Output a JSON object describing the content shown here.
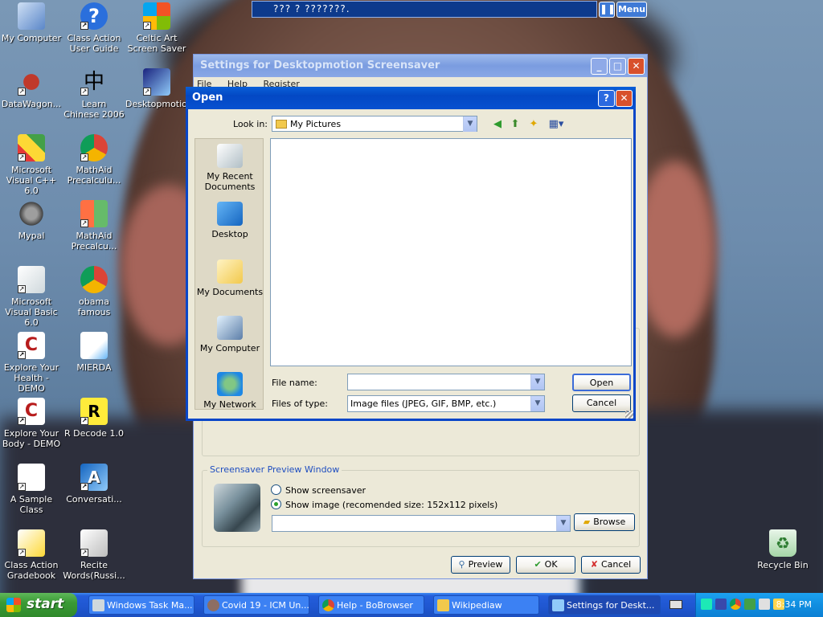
{
  "top_bar": {
    "text": "??? ? ???????.",
    "menu_label": "Menu",
    "pause_label": "❚❚"
  },
  "desktop_icons": [
    {
      "label": "My Computer"
    },
    {
      "label": "Class Action User Guide"
    },
    {
      "label": "Celtic Art Screen Saver"
    },
    {
      "label": "DataWagon..."
    },
    {
      "label": "Learn Chinese 2006"
    },
    {
      "label": "Desktopmotion"
    },
    {
      "label": "Microsoft Visual C++ 6.0"
    },
    {
      "label": "MathAid Precalculu..."
    },
    {
      "label": "Mypal"
    },
    {
      "label": "MathAid Precalcu..."
    },
    {
      "label": "Microsoft Visual Basic 6.0"
    },
    {
      "label": "obama famous"
    },
    {
      "label": "Explore Your Health - DEMO"
    },
    {
      "label": "MIERDA"
    },
    {
      "label": "Explore Your Body - DEMO"
    },
    {
      "label": "R Decode 1.0"
    },
    {
      "label": "A Sample Class"
    },
    {
      "label": "Conversati..."
    },
    {
      "label": "Class Action Gradebook"
    },
    {
      "label": "Recite Words(Russi..."
    },
    {
      "label": "Recycle Bin"
    }
  ],
  "settings_window": {
    "title": "Settings for Desktopmotion Screensaver",
    "menu": [
      "File",
      "Help",
      "Register"
    ],
    "preview_group": {
      "label": "Screensaver Preview Window",
      "option_show_screensaver": "Show screensaver",
      "option_show_image": "Show image (recomended size: 152x112 pixels)",
      "selected": "show_image",
      "path_value": "",
      "browse_label": "Browse"
    },
    "buttons": {
      "preview": "Preview",
      "ok": "OK",
      "cancel": "Cancel"
    }
  },
  "open_dialog": {
    "title": "Open",
    "look_in_label": "Look in:",
    "look_in_value": "My Pictures",
    "places": [
      {
        "label": "My Recent Documents",
        "icon": "recent-documents-icon"
      },
      {
        "label": "Desktop",
        "icon": "desktop-icon"
      },
      {
        "label": "My Documents",
        "icon": "my-documents-icon"
      },
      {
        "label": "My Computer",
        "icon": "my-computer-icon"
      },
      {
        "label": "My Network",
        "icon": "my-network-icon"
      }
    ],
    "file_name_label": "File name:",
    "file_name_value": "",
    "files_of_type_label": "Files of type:",
    "files_of_type_value": "Image files (JPEG, GIF, BMP, etc.)",
    "open_button": "Open",
    "cancel_button": "Cancel",
    "help_button": "?",
    "close_button": "✕"
  },
  "taskbar": {
    "start_label": "start",
    "tasks": [
      {
        "label": "Windows Task Ma..."
      },
      {
        "label": "Covid 19 - ICM Un..."
      },
      {
        "label": "Help - BoBrowser"
      },
      {
        "label": "Wikipediaw"
      },
      {
        "label": "Settings for Deskt..."
      }
    ],
    "clock": "8:34 PM"
  }
}
